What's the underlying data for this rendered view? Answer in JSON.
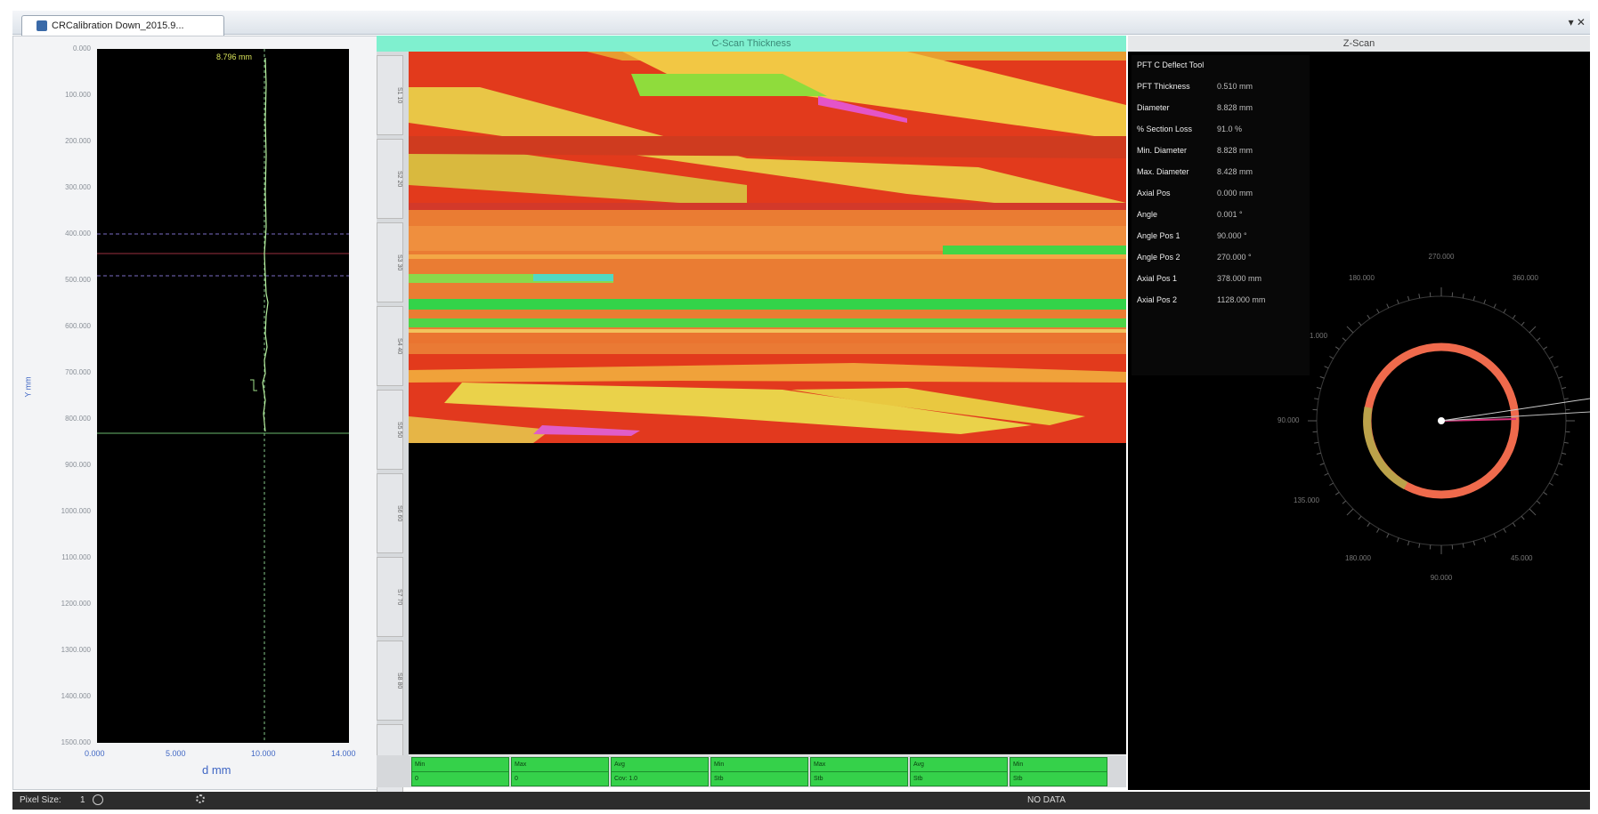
{
  "window": {
    "tab_title": "CRCalibration Down_2015.9...",
    "controls": "▾ ✕"
  },
  "left_plot": {
    "marker_value": "8.796 mm",
    "y_axis_label": "Y mm",
    "x_axis_label": "d mm",
    "y_ticks": [
      "0.000",
      "100.000",
      "200.000",
      "300.000",
      "400.000",
      "500.000",
      "600.000",
      "700.000",
      "800.000",
      "900.000",
      "1000.000",
      "1100.000",
      "1200.000",
      "1300.000",
      "1400.000",
      "1500.000"
    ],
    "x_ticks": [
      "0.000",
      "5.000",
      "10.000",
      "14.000"
    ]
  },
  "cscan": {
    "header": "C-Scan Thickness",
    "sections": [
      "S1 10",
      "S2 20",
      "S3 30",
      "S4 40",
      "S5 50",
      "S6 60",
      "S7 70",
      "S8 80",
      "S9 90"
    ],
    "status_cells": [
      {
        "label": "Min",
        "value": "0"
      },
      {
        "label": "Max",
        "value": "0"
      },
      {
        "label": "Avg",
        "value": "Cov: 1.0"
      },
      {
        "label": "Min",
        "value": "Stb"
      },
      {
        "label": "Max",
        "value": "Stb"
      },
      {
        "label": "Avg",
        "value": "Stb"
      },
      {
        "label": "Min",
        "value": "Stb"
      }
    ]
  },
  "zscan": {
    "header": "Z-Scan",
    "info": [
      {
        "label": "PFT C Deflect Tool",
        "value": ""
      },
      {
        "label": "PFT Thickness",
        "value": "0.510 mm"
      },
      {
        "label": "Diameter",
        "value": "8.828 mm"
      },
      {
        "label": "% Section Loss",
        "value": "91.0 %"
      },
      {
        "label": "Min. Diameter",
        "value": "8.828 mm"
      },
      {
        "label": "Max. Diameter",
        "value": "8.428 mm"
      },
      {
        "label": "Axial Pos",
        "value": "0.000 mm"
      },
      {
        "label": "Angle",
        "value": "0.001 °"
      },
      {
        "label": "Angle Pos 1",
        "value": "90.000 °"
      },
      {
        "label": "Angle Pos 2",
        "value": "270.000 °"
      },
      {
        "label": "Axial Pos 1",
        "value": "378.000 mm"
      },
      {
        "label": "Axial Pos 2",
        "value": "1128.000 mm"
      }
    ],
    "polar_labels": {
      "top": "270.000",
      "top_left": "180.000",
      "top_right": "360.000",
      "left": "1.000",
      "left_mid": "90.000",
      "bottom_left": "135.000",
      "bottom": "90.000",
      "bottom_right": "45.000",
      "bot_far_left": "180.000"
    }
  },
  "statusbar": {
    "pixel_size_label": "Pixel Size:",
    "pixel_size_value": "1",
    "message": "NO DATA"
  },
  "colors": {
    "accent_header": "#7ff0cf",
    "grid_green": "#35d14a",
    "background": "#000000"
  }
}
